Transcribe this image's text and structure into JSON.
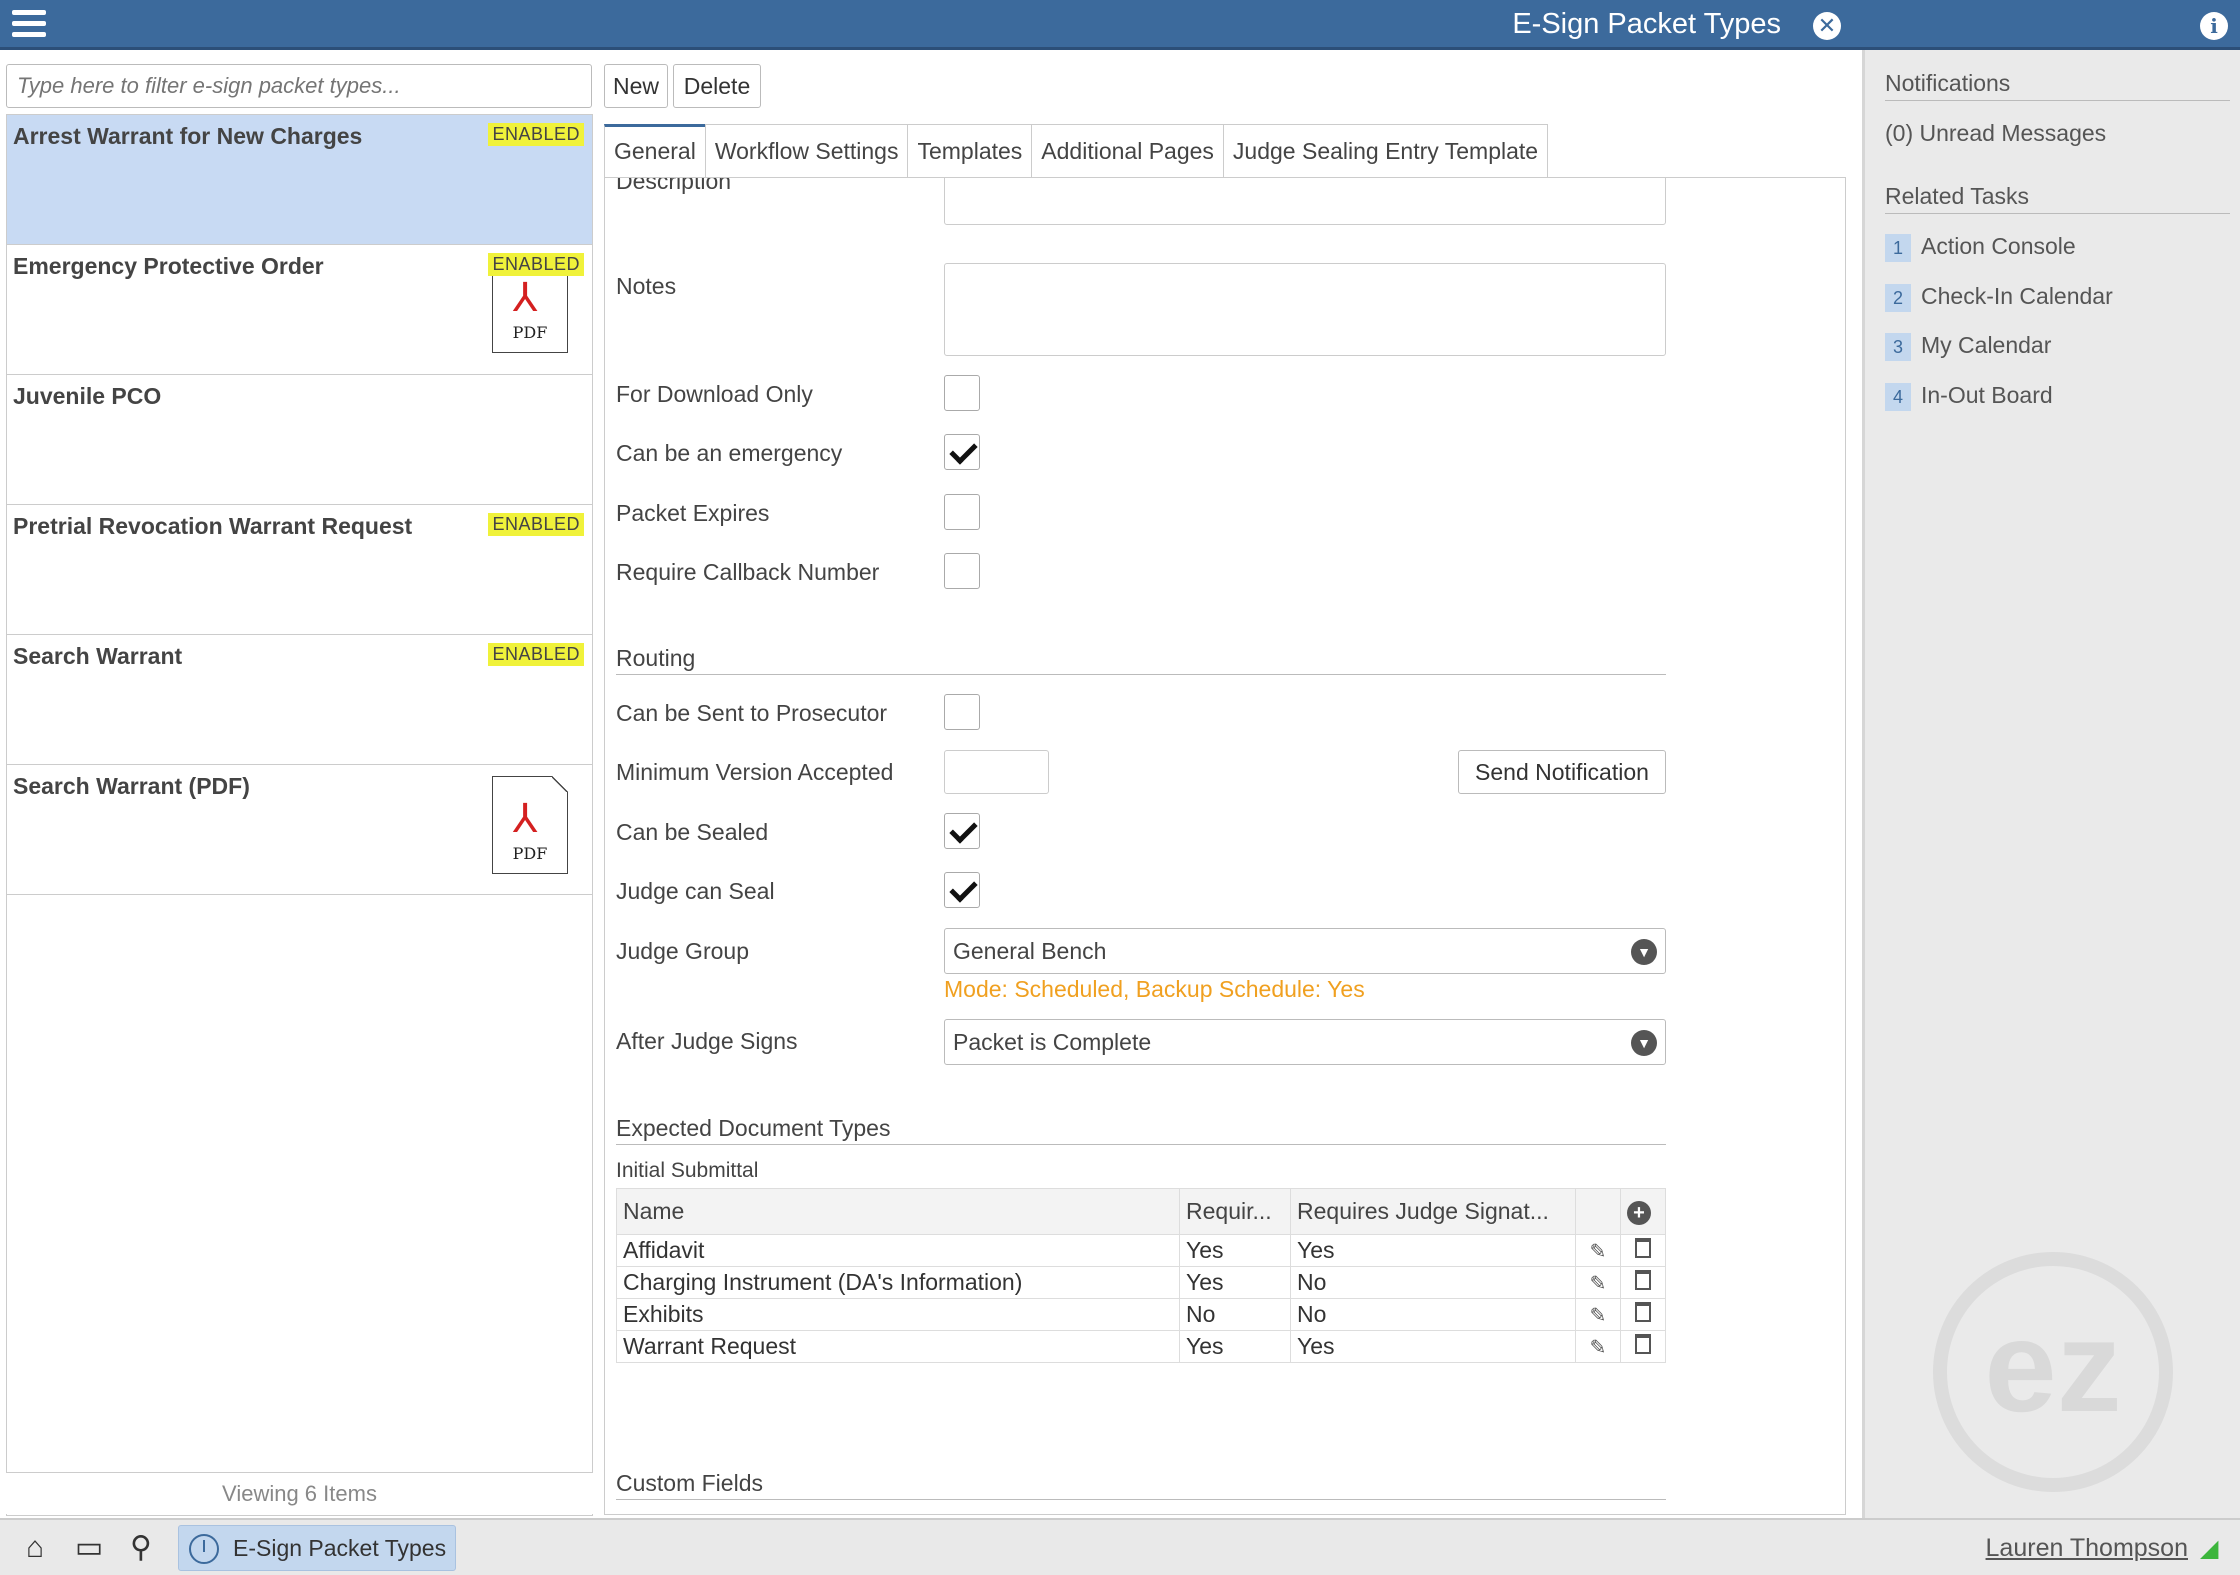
{
  "app": {
    "title": "E-Sign Packet Types"
  },
  "filter": {
    "placeholder": "Type here to filter e-sign packet types..."
  },
  "toolbar": {
    "new_label": "New",
    "delete_label": "Delete"
  },
  "list": {
    "items": [
      {
        "name": "Arrest Warrant for New Charges",
        "badge": "ENABLED",
        "pdf": false,
        "selected": true
      },
      {
        "name": "Emergency Protective Order",
        "badge": "ENABLED",
        "pdf": true
      },
      {
        "name": "Juvenile PCO",
        "badge": "",
        "pdf": false
      },
      {
        "name": "Pretrial Revocation Warrant Request",
        "badge": "ENABLED",
        "pdf": false
      },
      {
        "name": "Search Warrant",
        "badge": "ENABLED",
        "pdf": false
      },
      {
        "name": "Search Warrant (PDF)",
        "badge": "",
        "pdf": true
      }
    ],
    "pdf_label": "PDF",
    "footer": "Viewing 6 Items"
  },
  "tabs": [
    "General",
    "Workflow Settings",
    "Templates",
    "Additional Pages",
    "Judge Sealing Entry Template"
  ],
  "form": {
    "description_label": "Description",
    "notes_label": "Notes",
    "for_download_only": {
      "label": "For Download Only",
      "checked": false
    },
    "can_be_emergency": {
      "label": "Can be an emergency",
      "checked": true
    },
    "packet_expires": {
      "label": "Packet Expires",
      "checked": false
    },
    "require_callback": {
      "label": "Require Callback Number",
      "checked": false
    },
    "routing_title": "Routing",
    "sent_to_prosecutor": {
      "label": "Can be Sent to Prosecutor",
      "checked": false
    },
    "min_version_label": "Minimum Version Accepted",
    "send_notification_label": "Send Notification",
    "can_be_sealed": {
      "label": "Can be Sealed",
      "checked": true
    },
    "judge_can_seal": {
      "label": "Judge can Seal",
      "checked": true
    },
    "judge_group_label": "Judge Group",
    "judge_group_value": "General Bench",
    "judge_group_note": "Mode: Scheduled, Backup Schedule: Yes",
    "after_judge_signs_label": "After Judge Signs",
    "after_judge_signs_value": "Packet is Complete",
    "expected_docs_title": "Expected Document Types",
    "initial_submittal_title": "Initial Submittal",
    "table_headers": [
      "Name",
      "Requir...",
      "Requires Judge Signat..."
    ],
    "table_rows": [
      [
        "Affidavit",
        "Yes",
        "Yes"
      ],
      [
        "Charging Instrument (DA's Information)",
        "Yes",
        "No"
      ],
      [
        "Exhibits",
        "No",
        "No"
      ],
      [
        "Warrant Request",
        "Yes",
        "Yes"
      ]
    ],
    "custom_fields_title": "Custom Fields"
  },
  "sidebar": {
    "notifications_title": "Notifications",
    "unread": "(0) Unread Messages",
    "related_title": "Related Tasks",
    "tasks": [
      {
        "num": "1",
        "label": "Action Console"
      },
      {
        "num": "2",
        "label": "Check-In Calendar"
      },
      {
        "num": "3",
        "label": "My Calendar"
      },
      {
        "num": "4",
        "label": "In-Out Board"
      }
    ]
  },
  "bottombar": {
    "task_label": "E-Sign Packet Types",
    "user": "Lauren Thompson"
  },
  "colors": {
    "accent": "#3c6a9c",
    "badge": "#f0f23a",
    "note": "#f0a020",
    "selected": "#c8daf3"
  }
}
